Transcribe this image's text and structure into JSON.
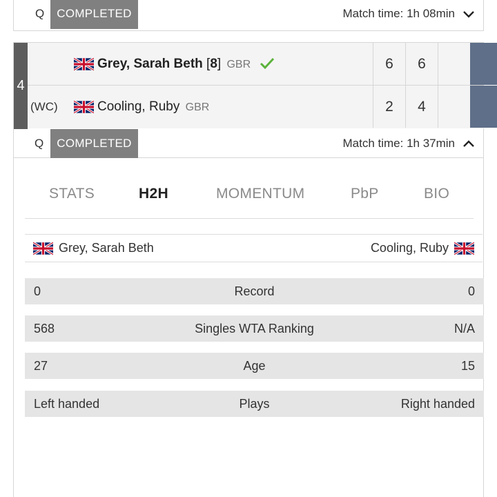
{
  "previous_match": {
    "round": "Q",
    "status": "COMPLETED",
    "match_time": "Match time: 1h 08min",
    "toggle_icon": "chevron-down-icon"
  },
  "match": {
    "number": "4",
    "round": "Q",
    "status": "COMPLETED",
    "match_time": "Match time: 1h 37min",
    "toggle_icon": "chevron-up-icon",
    "accent_color": "#5f6f89",
    "players": [
      {
        "entry": "",
        "flag": "gb-flag-icon",
        "name": "Grey, Sarah Beth",
        "seed": "[8]",
        "nationality": "GBR",
        "winner": true,
        "sets": [
          "6",
          "6",
          ""
        ]
      },
      {
        "entry": "(WC)",
        "flag": "gb-flag-icon",
        "name": "Cooling, Ruby",
        "seed": "",
        "nationality": "GBR",
        "winner": false,
        "sets": [
          "2",
          "4",
          ""
        ]
      }
    ]
  },
  "detail": {
    "tabs": [
      {
        "label": "STATS",
        "active": false
      },
      {
        "label": "H2H",
        "active": true
      },
      {
        "label": "MOMENTUM",
        "active": false
      },
      {
        "label": "PbP",
        "active": false
      },
      {
        "label": "BIO",
        "active": false
      }
    ],
    "h2h": {
      "left_player": "Grey, Sarah Beth",
      "right_player": "Cooling, Ruby",
      "rows": [
        {
          "left": "0",
          "label": "Record",
          "right": "0"
        },
        {
          "left": "568",
          "label": "Singles WTA Ranking",
          "right": "N/A"
        },
        {
          "left": "27",
          "label": "Age",
          "right": "15"
        },
        {
          "left": "Left handed",
          "label": "Plays",
          "right": "Right handed"
        }
      ]
    }
  }
}
